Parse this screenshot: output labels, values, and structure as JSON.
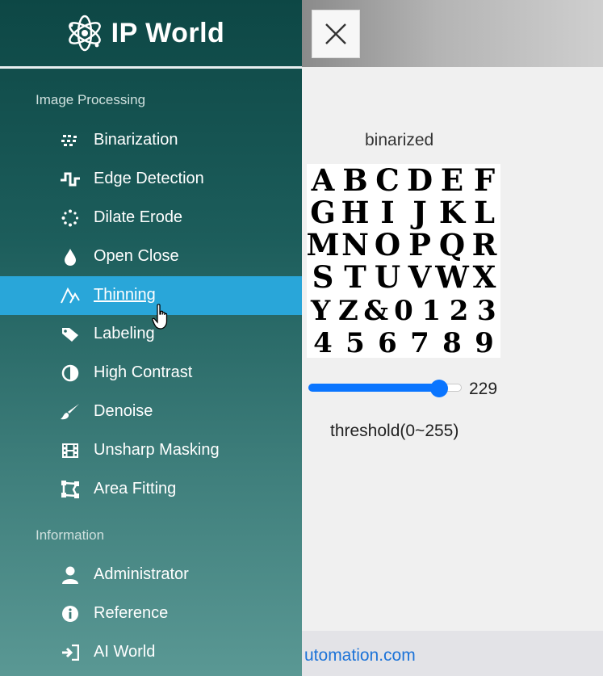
{
  "brand": {
    "title": "IP World",
    "icon": "atom-logo-icon"
  },
  "sidebar": {
    "sections": [
      {
        "title": "Image Processing",
        "items": [
          {
            "label": "Binarization",
            "icon": "grid-dots-icon"
          },
          {
            "label": "Edge Detection",
            "icon": "square-wave-icon"
          },
          {
            "label": "Dilate Erode",
            "icon": "circle-dots-icon"
          },
          {
            "label": "Open Close",
            "icon": "droplet-icon"
          },
          {
            "label": "Thinning",
            "icon": "thin-lines-icon",
            "active": true
          },
          {
            "label": "Labeling",
            "icon": "tag-icon"
          },
          {
            "label": "High Contrast",
            "icon": "contrast-icon"
          },
          {
            "label": "Denoise",
            "icon": "brush-icon"
          },
          {
            "label": "Unsharp Masking",
            "icon": "film-icon"
          },
          {
            "label": "Area Fitting",
            "icon": "crop-area-icon"
          }
        ]
      },
      {
        "title": "Information",
        "items": [
          {
            "label": "Administrator",
            "icon": "user-icon"
          },
          {
            "label": "Reference",
            "icon": "info-icon"
          },
          {
            "label": "AI World",
            "icon": "sign-in-icon"
          }
        ]
      }
    ]
  },
  "main": {
    "image_caption": "binarized",
    "image_glyph_rows": [
      [
        "A",
        "B",
        "C",
        "D",
        "E",
        "F"
      ],
      [
        "G",
        "H",
        "I",
        "J",
        "K",
        "L"
      ],
      [
        "M",
        "N",
        "O",
        "P",
        "Q",
        "R"
      ],
      [
        "S",
        "T",
        "U",
        "V",
        "W",
        "X"
      ],
      [
        "Y",
        "Z",
        "&",
        "0",
        "1",
        "2",
        "3"
      ],
      [
        "4",
        "5",
        "6",
        "7",
        "8",
        "9"
      ]
    ],
    "slider": {
      "value": 229,
      "min": 0,
      "max": 255,
      "label": "threshold(0~255)"
    },
    "footer_link": "utomation.com"
  },
  "colors": {
    "sidebar_top": "#0d4745",
    "sidebar_bottom": "#5a9894",
    "active_item": "#29a6d9",
    "slider_accent": "#0a75ff",
    "link": "#1c73d8"
  }
}
